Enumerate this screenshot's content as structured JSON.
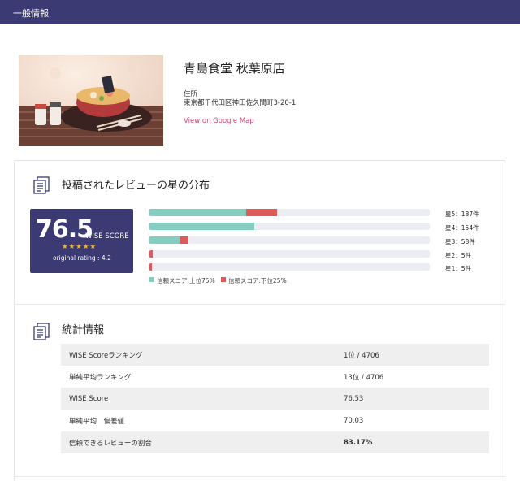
{
  "header": {
    "title": "一般情報"
  },
  "shop": {
    "name": "青島食堂 秋葉原店",
    "address_label": "住所",
    "address": "東京都千代田区神田佐久間町3-20-1",
    "map_link": "View on Google Map"
  },
  "distribution": {
    "title": "投稿されたレビューの星の分布",
    "score": {
      "value": "76.5",
      "suffix": "WISE SCORE",
      "stars": "★★★★★",
      "original": "original rating : 4.2"
    },
    "bars": [
      {
        "label": "星5：187件",
        "trusted_fraction": 0.347,
        "untrusted_fraction": 0.11
      },
      {
        "label": "星4：154件",
        "trusted_fraction": 0.376,
        "untrusted_fraction": 0.0
      },
      {
        "label": "星3：58件",
        "trusted_fraction": 0.11,
        "untrusted_fraction": 0.032
      },
      {
        "label": "星2：5件",
        "trusted_fraction": 0.0,
        "untrusted_fraction": 0.014
      },
      {
        "label": "星1：5件",
        "trusted_fraction": 0.0,
        "untrusted_fraction": 0.012
      }
    ],
    "legend": {
      "trusted": "信頼スコア:上位75%",
      "untrusted": "信頼スコア:下位25%"
    },
    "colors": {
      "trusted": "#86cdc1",
      "untrusted": "#e05a5a",
      "track": "#ecedf2"
    }
  },
  "stats": {
    "title": "統計情報",
    "rows": [
      {
        "label": "WISE Scoreランキング",
        "value": "1位 / 4706"
      },
      {
        "label": "単純平均ランキング",
        "value": "13位 / 4706"
      },
      {
        "label": "WISE Score",
        "value": "76.53"
      },
      {
        "label": "単純平均　偏差値",
        "value": "70.03"
      },
      {
        "label": "信頼できるレビューの割合",
        "value": "83.17%"
      }
    ]
  },
  "icons": {
    "section": "document-icon",
    "image": "ramen-bowl-image"
  }
}
